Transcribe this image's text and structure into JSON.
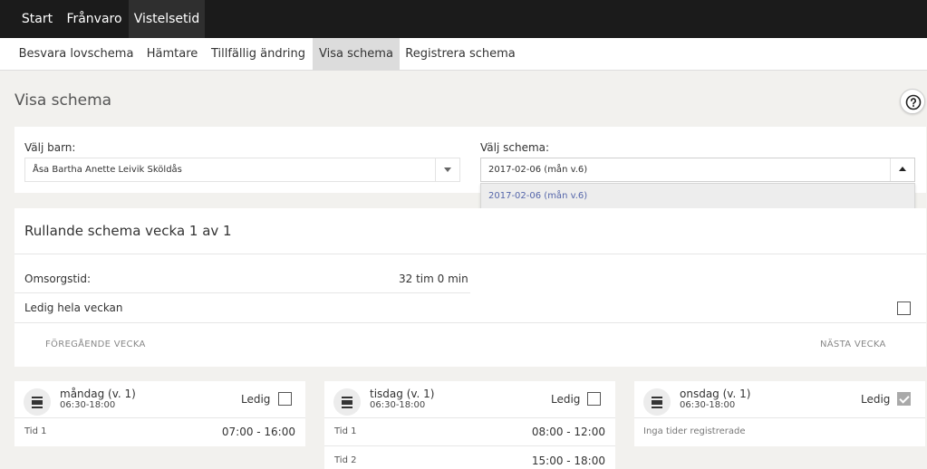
{
  "topnav": {
    "items": [
      {
        "label": "Start"
      },
      {
        "label": "Frånvaro"
      },
      {
        "label": "Vistelsetid"
      }
    ]
  },
  "subnav": {
    "items": [
      {
        "label": "Besvara lovschema"
      },
      {
        "label": "Hämtare"
      },
      {
        "label": "Tillfällig ändring"
      },
      {
        "label": "Visa schema"
      },
      {
        "label": "Registrera schema"
      }
    ]
  },
  "page": {
    "title": "Visa schema",
    "help_icon": "question-circle-icon"
  },
  "selectors": {
    "child_label": "Välj barn:",
    "child_value": "Åsa Bartha Anette Leivik Sköldås",
    "schema_label": "Välj schema:",
    "schema_value": "2017-02-06 (mån v.6)",
    "schema_options": [
      "2017-02-06 (mån v.6)"
    ]
  },
  "schedule": {
    "title": "Rullande schema vecka 1 av 1",
    "omsorgstid_label": "Omsorgstid:",
    "omsorgstid_value": "32 tim 0 min",
    "ledig_week_label": "Ledig hela veckan",
    "ledig_week_checked": false,
    "prev_week": "FÖREGÅENDE VECKA",
    "next_week": "NÄSTA VECKA"
  },
  "days": [
    {
      "title": "måndag (v. 1)",
      "hours": "06:30-18:00",
      "ledig_label": "Ledig",
      "ledig_checked": false,
      "rows": [
        {
          "label": "Tid 1",
          "value": "07:00 - 16:00"
        }
      ]
    },
    {
      "title": "tisdag (v. 1)",
      "hours": "06:30-18:00",
      "ledig_label": "Ledig",
      "ledig_checked": false,
      "rows": [
        {
          "label": "Tid 1",
          "value": "08:00 - 12:00"
        },
        {
          "label": "Tid 2",
          "value": "15:00 - 18:00"
        }
      ]
    },
    {
      "title": "onsdag (v. 1)",
      "hours": "06:30-18:00",
      "ledig_label": "Ledig",
      "ledig_checked": true,
      "empty_text": "Inga tider registrerade"
    }
  ],
  "colors": {
    "topnav_bg": "#1b1b1b",
    "active_subtab": "#dcdcdc",
    "dropdown_option": "#5566aa"
  }
}
